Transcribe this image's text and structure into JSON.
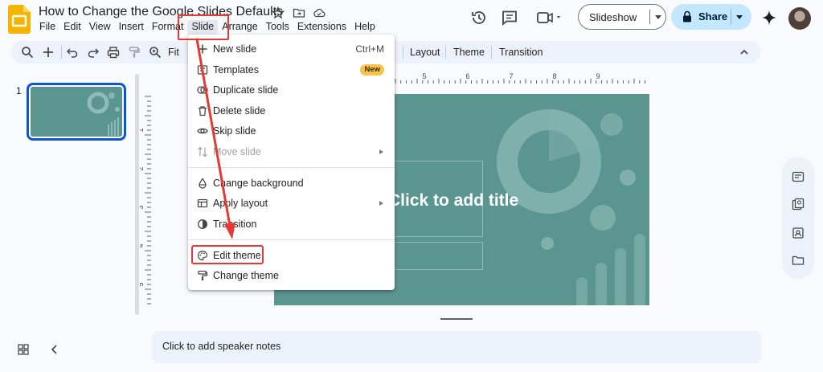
{
  "doc": {
    "title": "How to Change the Google Slides Defaults"
  },
  "menubar": [
    "File",
    "Edit",
    "View",
    "Insert",
    "Format",
    "Slide",
    "Arrange",
    "Tools",
    "Extensions",
    "Help"
  ],
  "header": {
    "slideshow_label": "Slideshow",
    "share_label": "Share"
  },
  "toolbar": {
    "zoom_label": "Fit",
    "layout_label": "Layout",
    "theme_label": "Theme",
    "transition_label": "Transition"
  },
  "filmstrip": {
    "slide_number": "1"
  },
  "slide": {
    "title_placeholder": "Click to add title"
  },
  "ruler": {
    "top_numbers": [
      "5",
      "6",
      "7",
      "8",
      "9"
    ],
    "left_numbers": [
      "1",
      "2",
      "3",
      "4",
      "5"
    ]
  },
  "slide_menu": {
    "items": [
      {
        "label": "New slide",
        "shortcut": "Ctrl+M",
        "icon": "plus-icon"
      },
      {
        "label": "Templates",
        "badge": "New",
        "icon": "templates-icon"
      },
      {
        "label": "Duplicate slide",
        "icon": "duplicate-icon"
      },
      {
        "label": "Delete slide",
        "icon": "trash-icon"
      },
      {
        "label": "Skip slide",
        "icon": "eye-icon"
      },
      {
        "label": "Move slide",
        "disabled": true,
        "submenu": true,
        "icon": "move-icon"
      },
      {
        "label": "Change background",
        "icon": "drop-icon"
      },
      {
        "label": "Apply layout",
        "submenu": true,
        "icon": "layout-icon"
      },
      {
        "label": "Transition",
        "icon": "transition-icon"
      },
      {
        "label": "Edit theme",
        "icon": "palette-icon"
      },
      {
        "label": "Change theme",
        "icon": "paint-roller-icon"
      }
    ]
  },
  "notes": {
    "placeholder": "Click to add speaker notes"
  },
  "colors": {
    "accent_blue": "#0b57d0",
    "share_bg": "#c2e7ff",
    "slide_bg": "#5b9590",
    "annotation_red": "#e53935",
    "badge_yellow": "#f8c34b"
  }
}
